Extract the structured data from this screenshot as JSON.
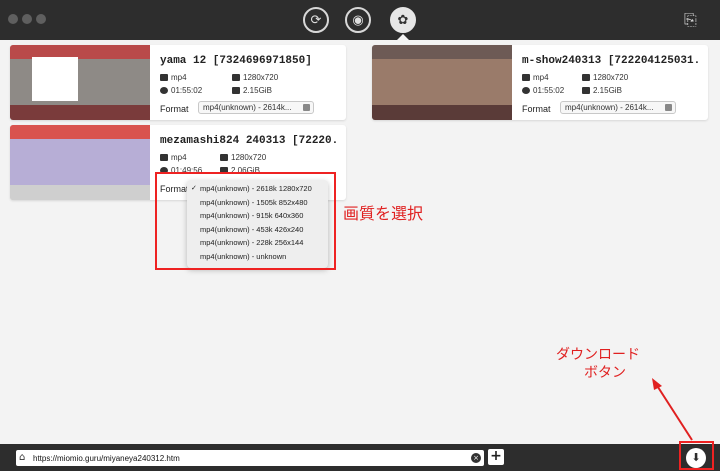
{
  "toolbar": {
    "tab_icons": [
      "convert-icon",
      "record-icon",
      "film-reel-icon"
    ],
    "active_tab": 2,
    "right_icon": "export-icon"
  },
  "videos": [
    {
      "title": "yama 12 [7324696971850]",
      "format": "mp4",
      "resolution": "1280x720",
      "duration": "01:55:02",
      "size": "2.15GiB",
      "format_label": "Format",
      "format_value": "mp4(unknown) - 2614k..."
    },
    {
      "title": "m-show240313 [722204125031...",
      "format": "mp4",
      "resolution": "1280x720",
      "duration": "01:55:02",
      "size": "2.15GiB",
      "format_label": "Format",
      "format_value": "mp4(unknown) - 2614k..."
    },
    {
      "title": "mezamashi824 240313 [72220...",
      "format": "mp4",
      "resolution": "1280x720",
      "duration": "01:49:56",
      "size": "2.06GiB",
      "format_label": "Format",
      "format_value": "mp4(unknown) - 2618k 1280x720"
    }
  ],
  "dropdown": {
    "options": [
      "mp4(unknown) - 2618k 1280x720",
      "mp4(unknown) - 1505k 852x480",
      "mp4(unknown) - 915k 640x360",
      "mp4(unknown) - 453k 426x240",
      "mp4(unknown) - 228k 256x144",
      "mp4(unknown) -  unknown"
    ],
    "selected_index": 0
  },
  "annotations": {
    "quality_select": "画質を選択",
    "download_line1": "ダウンロード",
    "download_line2": "ボタン",
    "color": "#e02020"
  },
  "bottombar": {
    "url": "https://miomio.guru/miyaneya240312.htm"
  }
}
